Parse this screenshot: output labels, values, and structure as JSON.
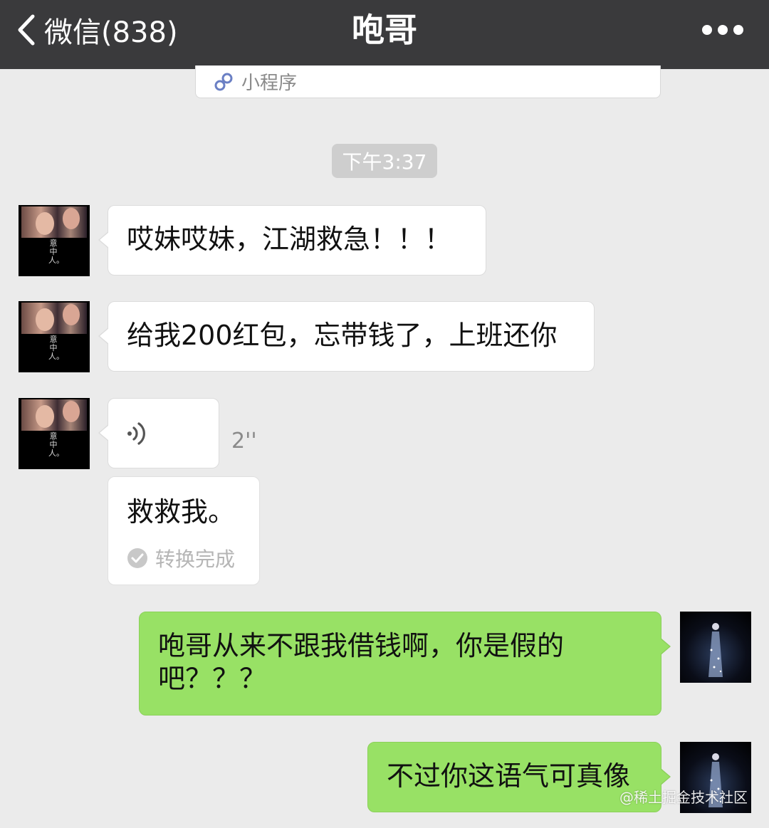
{
  "nav": {
    "back_label": "微信(838)",
    "title": "咆哥",
    "more_icon": "more-dots-icon"
  },
  "mini_program": {
    "label": "小程序",
    "icon": "mini-program-link-icon"
  },
  "timestamp": "下午3:37",
  "messages": [
    {
      "side": "left",
      "type": "text",
      "text": "哎妹哎妹，江湖救急！！！"
    },
    {
      "side": "left",
      "type": "text",
      "text": "给我200红包，忘带钱了，上班还你"
    },
    {
      "side": "left",
      "type": "voice",
      "duration": "2''",
      "icon": "voice-wave-icon"
    },
    {
      "side": "left",
      "type": "transcript",
      "text": "救救我。",
      "status": "转换完成",
      "status_icon": "check-circle-icon"
    },
    {
      "side": "right",
      "type": "text",
      "text": "咆哥从来不跟我借钱啊，你是假的吧？？？"
    },
    {
      "side": "right",
      "type": "text",
      "text": "不过你这语气可真像"
    }
  ],
  "avatar_left_caption": "意中人。",
  "watermark": "@稀土掘金技术社区",
  "colors": {
    "topbar": "#3a3a3c",
    "background": "#ebebeb",
    "bubble_self": "#98e165",
    "bubble_other": "#ffffff"
  }
}
